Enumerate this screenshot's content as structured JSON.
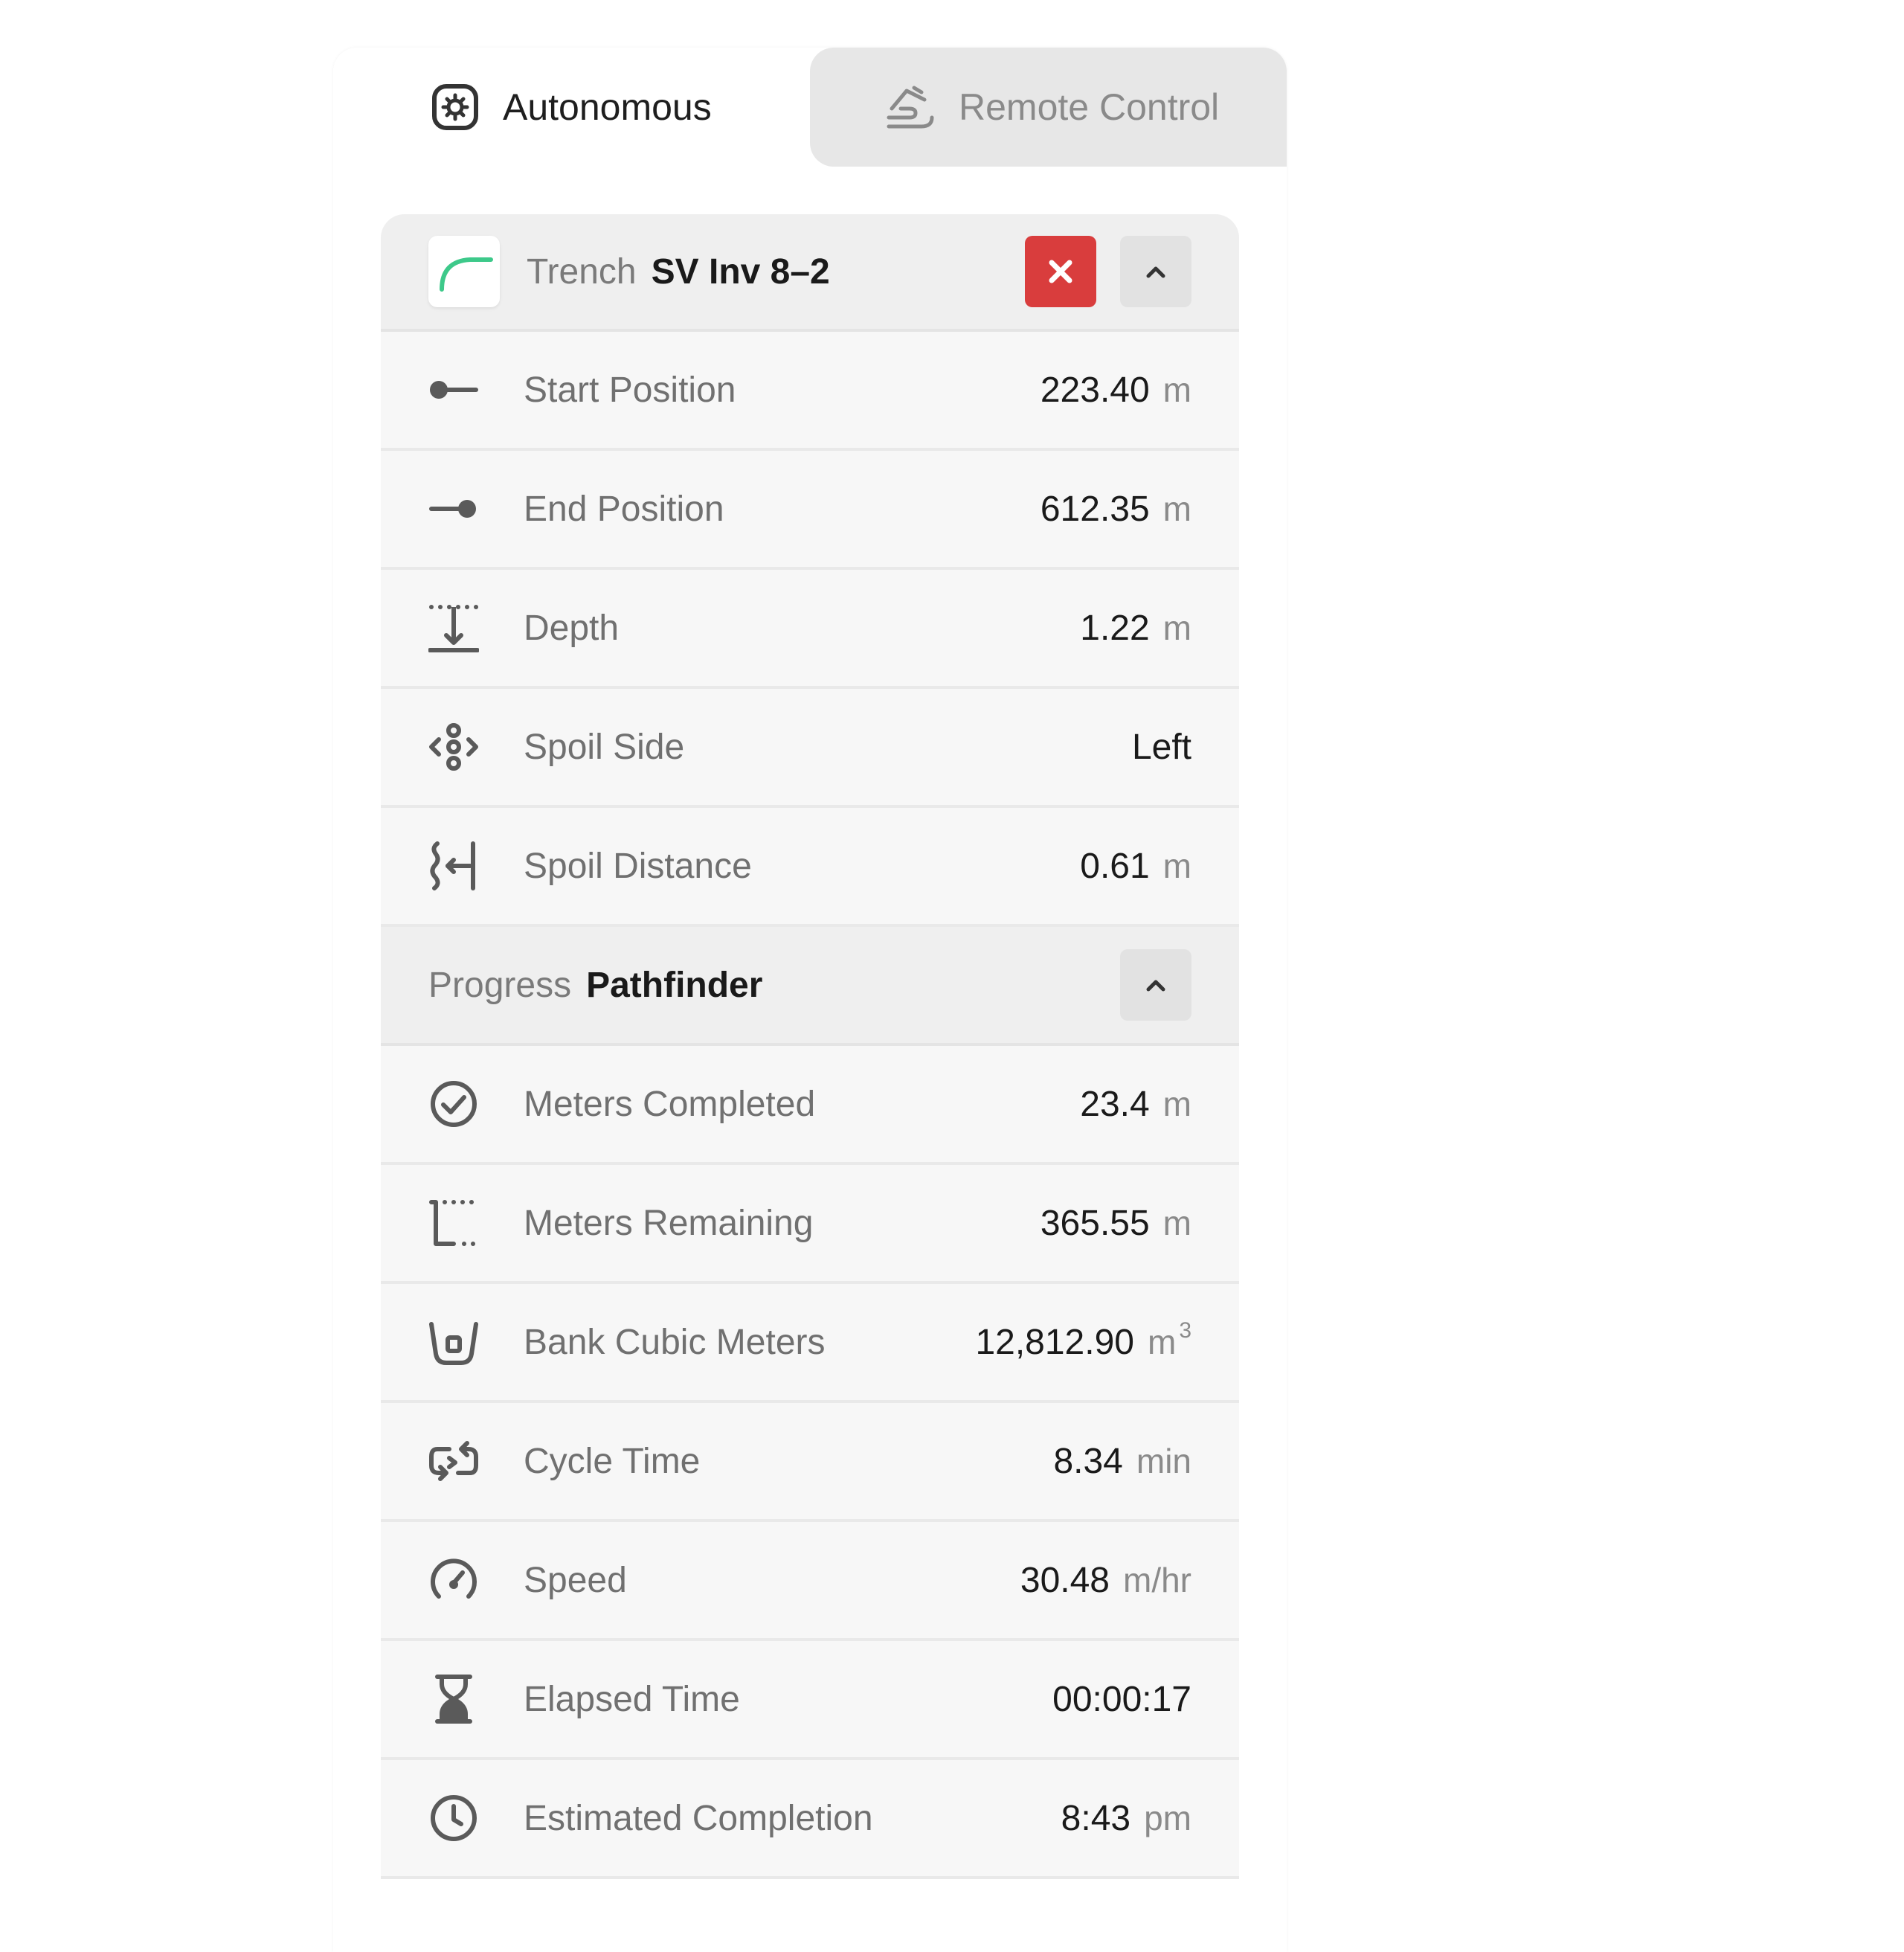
{
  "tabs": [
    {
      "label": "Autonomous",
      "icon": "gear-chip-icon",
      "active": true
    },
    {
      "label": "Remote Control",
      "icon": "hand-remote-icon",
      "active": false
    }
  ],
  "trench": {
    "label": "Trench",
    "name": "SV Inv 8–2",
    "icon": "trench-path-icon",
    "accent": "#3dc98a",
    "close_color": "#d93d3d",
    "rows": [
      {
        "label": "Start Position",
        "value": "223.40",
        "unit": "m",
        "icon": "start-position-icon"
      },
      {
        "label": "End Position",
        "value": "612.35",
        "unit": "m",
        "icon": "end-position-icon"
      },
      {
        "label": "Depth",
        "value": "1.22",
        "unit": "m",
        "icon": "depth-icon"
      },
      {
        "label": "Spoil Side",
        "value": "Left",
        "unit": "",
        "icon": "spoil-side-icon"
      },
      {
        "label": "Spoil Distance",
        "value": "0.61",
        "unit": "m",
        "icon": "spoil-distance-icon"
      }
    ]
  },
  "progress": {
    "label": "Progress",
    "name": "Pathfinder",
    "rows": [
      {
        "label": "Meters Completed",
        "value": "23.4",
        "unit": "m",
        "icon": "check-circle-icon"
      },
      {
        "label": "Meters Remaining",
        "value": "365.55",
        "unit": "m",
        "icon": "meters-remaining-icon"
      },
      {
        "label": "Bank Cubic Meters",
        "value": "12,812.90",
        "unit": "m",
        "unit_sup": "3",
        "icon": "bucket-icon"
      },
      {
        "label": "Cycle Time",
        "value": "8.34",
        "unit": "min",
        "icon": "cycle-icon"
      },
      {
        "label": "Speed",
        "value": "30.48",
        "unit": "m/hr",
        "icon": "speedometer-icon"
      },
      {
        "label": "Elapsed Time",
        "value": "00:00:17",
        "unit": "",
        "icon": "hourglass-icon"
      },
      {
        "label": "Estimated Completion",
        "value": "8:43",
        "unit": "pm",
        "icon": "clock-icon"
      }
    ]
  }
}
